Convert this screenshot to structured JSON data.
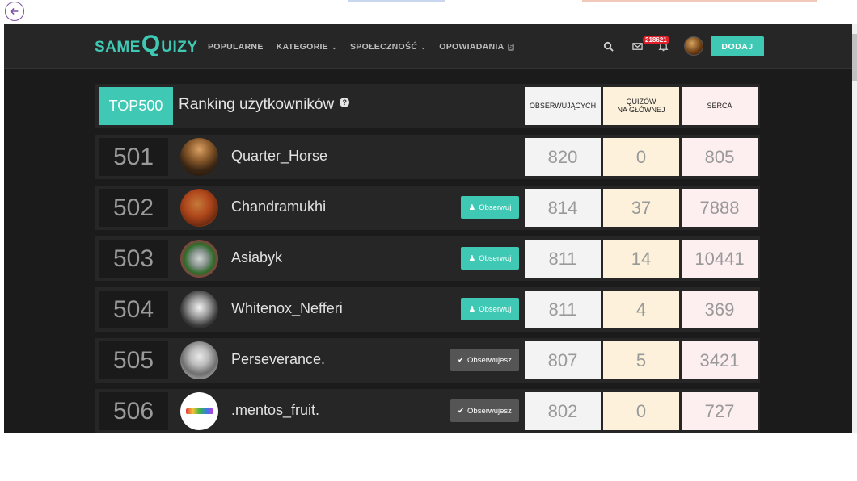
{
  "navbar": {
    "logo": {
      "part1": "SAME",
      "part2": "Q",
      "part3": "UIZY"
    },
    "menu": [
      {
        "label": "POPULARNE",
        "dropdown": false
      },
      {
        "label": "KATEGORIE",
        "dropdown": true
      },
      {
        "label": "SPOŁECZNOŚĆ",
        "dropdown": true
      },
      {
        "label": "OPOWIADANIA",
        "dropdown": false,
        "badge": "5"
      }
    ],
    "notifications_count": "218621",
    "add_label": "DODAJ",
    "accent_color": "#3fc9b4"
  },
  "ranking": {
    "badge": "TOP500",
    "title": "Ranking użytkowników",
    "columns": {
      "followers": "OBSERWUJĄCYCH",
      "quizzes_line1": "QUIZÓW",
      "quizzes_line2": "NA GŁÓWNEJ",
      "hearts": "SERCA"
    },
    "rows": [
      {
        "rank": "501",
        "username": "Quarter_Horse",
        "action": "",
        "followers": "820",
        "quizzes": "0",
        "hearts": "805"
      },
      {
        "rank": "502",
        "username": "Chandramukhi",
        "action": "Obserwuj",
        "followers": "814",
        "quizzes": "37",
        "hearts": "7888"
      },
      {
        "rank": "503",
        "username": "Asiabyk",
        "action": "Obserwuj",
        "followers": "811",
        "quizzes": "14",
        "hearts": "10441"
      },
      {
        "rank": "504",
        "username": "Whitenox_Nefferi",
        "action": "Obserwuj",
        "followers": "811",
        "quizzes": "4",
        "hearts": "369"
      },
      {
        "rank": "505",
        "username": "Perseverance.",
        "action": "Obserwujesz",
        "followers": "807",
        "quizzes": "5",
        "hearts": "3421"
      },
      {
        "rank": "506",
        "username": ".mentos_fruit.",
        "action": "Obserwujesz",
        "followers": "802",
        "quizzes": "0",
        "hearts": "727"
      }
    ]
  }
}
